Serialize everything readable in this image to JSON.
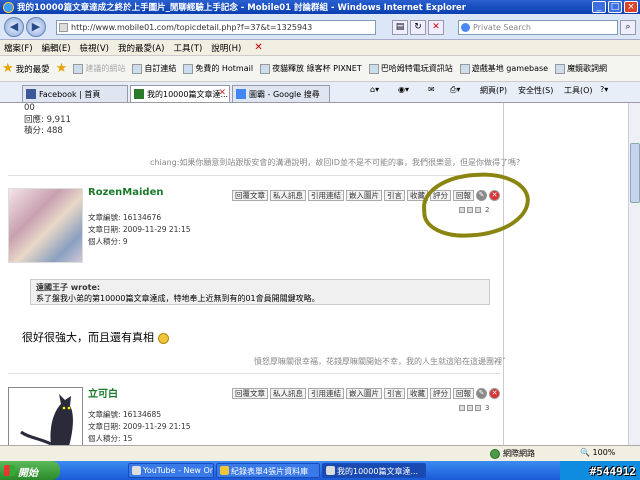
{
  "window": {
    "title": "我的10000篇文章達成之終於上手圖片_閒聊經驗上手記念 - Mobile01 討論群組 - Windows Internet Explorer"
  },
  "address": {
    "url": "http://www.mobile01.com/topicdetail.php?f=37&t=1325943",
    "search_placeholder": "Private Search"
  },
  "menu": [
    "檔案(F)",
    "編輯(E)",
    "檢視(V)",
    "我的最愛(A)",
    "工具(T)",
    "說明(H)"
  ],
  "favorites": {
    "label": "我的最愛",
    "items": [
      "建議的網站",
      "自訂連結",
      "免費的 Hotmail",
      "夜貓釋放 綠客杯 PIXNET",
      "巴哈姆特電玩資訊站",
      "遊戲基地 gamebase",
      "魔鏡歌詞網"
    ]
  },
  "tabs": [
    {
      "label": "Facebook | 首頁"
    },
    {
      "label": "我的10000篇文章達..."
    },
    {
      "label": "圖霸 - Google 搜尋"
    }
  ],
  "commands": {
    "page": "網頁(P)",
    "security": "安全性(S)",
    "tools": "工具(O)"
  },
  "post0": {
    "stats": [
      "回應: 9,911",
      "積分: 488"
    ],
    "stats_top": "00",
    "signature": "chiang:如果你願意到站跟版安會的溝通說明，故回ID並不是不可能的事，我們很樂意，但是你做得了嗎?"
  },
  "post1": {
    "username": "RozenMaiden",
    "meta": [
      "文章編號: 16134676",
      "文章日期: 2009-11-29 21:15",
      "個人積分: 9"
    ],
    "actions": [
      "回覆文章",
      "私人訊息",
      "引用連結",
      "嵌入圖片",
      "引言",
      "收藏",
      "評分",
      "回報"
    ],
    "post_number": "2",
    "quote_header": "遠國王子 wrote:",
    "quote_body": "系了盤我小弟的第10000篇文章達成，特地奉上近無到有的01會員開關鍵攻略。",
    "text": "很好很強大，而且還有真相",
    "signature": "憤怒厚嘛關很幸福，花錢厚嘛關開始不幸，我的人生就這陷在這邊團裡ˇ"
  },
  "post2": {
    "username": "立可白",
    "meta": [
      "文章編號: 16134685",
      "文章日期: 2009-11-29 21:15",
      "個人積分: 15"
    ],
    "actions": [
      "回覆文章",
      "私人訊息",
      "引用連結",
      "嵌入圖片",
      "引言",
      "收藏",
      "評分",
      "回報"
    ],
    "post_number": "3"
  },
  "statusbar": {
    "zone": "網際網路",
    "zoom": "100%"
  },
  "taskbar": {
    "start": "開始",
    "tasks": [
      "YouTube - New Order...",
      "紀錄表單4張片資料庫",
      "我的10000篇文章達..."
    ],
    "watermark": "#544912"
  },
  "colors": {
    "username": "#1a7a2a",
    "highlight": "#8a8410"
  }
}
